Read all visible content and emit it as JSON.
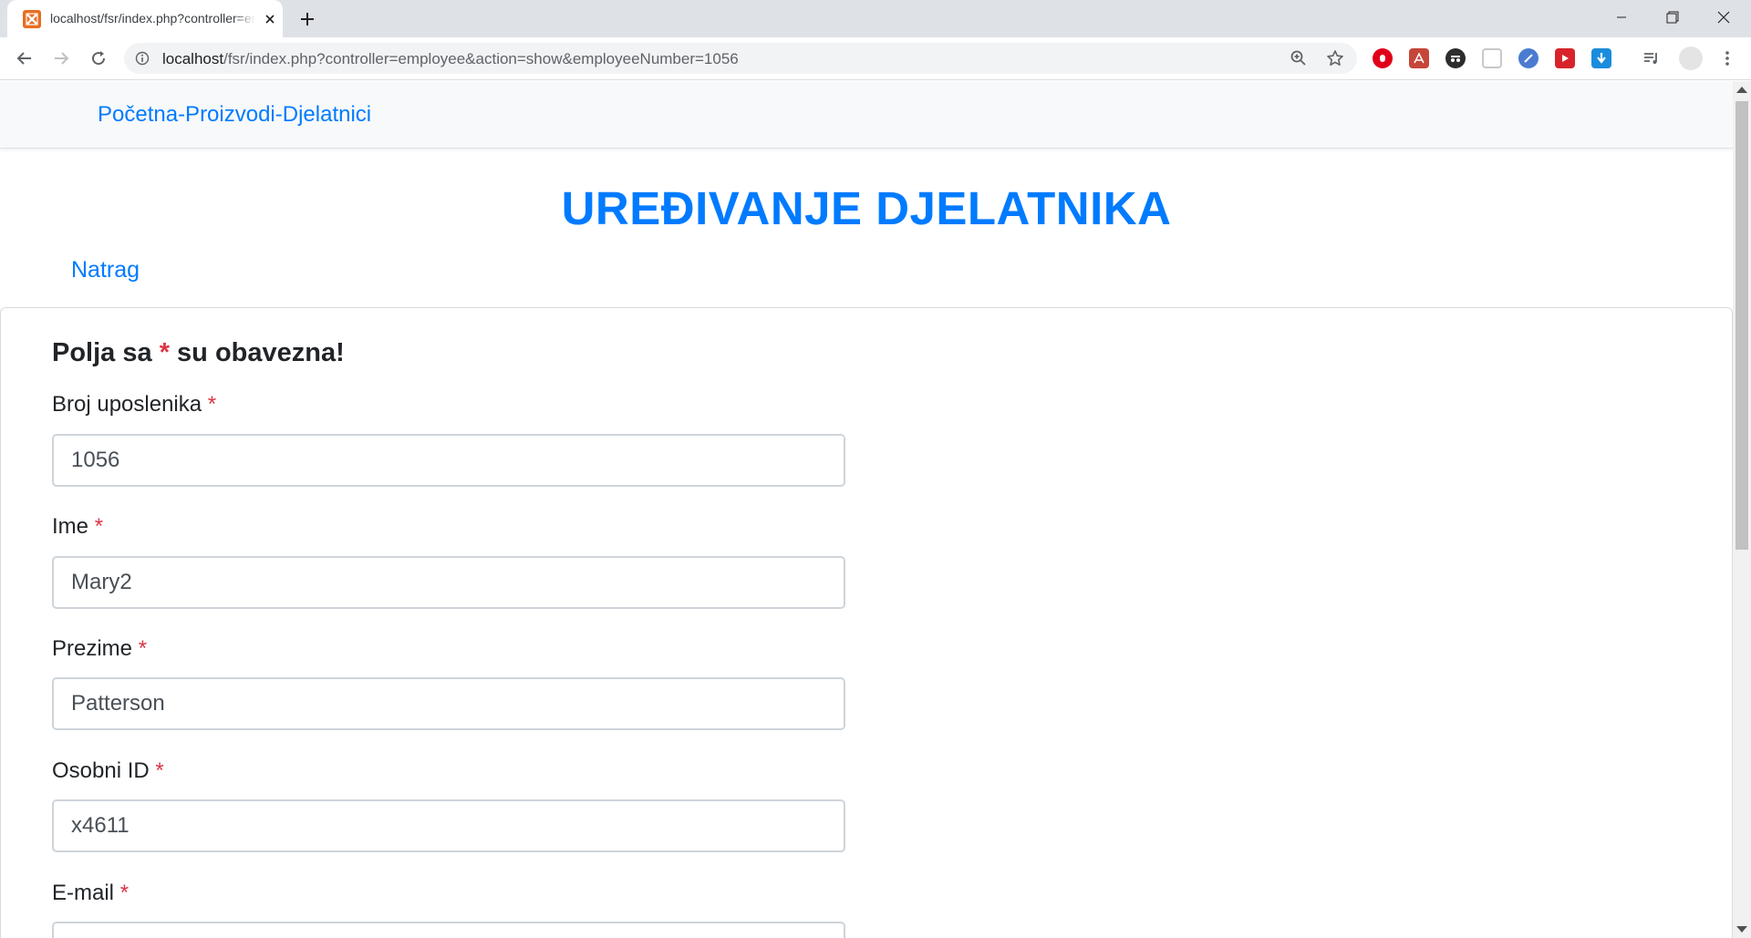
{
  "browser": {
    "tab_title": "localhost/fsr/index.php?controller=employee&action=show&employeeNumber=1056",
    "url_host": "localhost",
    "url_path": "/fsr/index.php?controller=employee&action=show&employeeNumber=1056"
  },
  "navbar": {
    "brand": "Početna-Proizvodi-Djelatnici"
  },
  "page": {
    "title": "UREĐIVANJE DJELATNIKA",
    "back_link": "Natrag"
  },
  "form": {
    "note_prefix": "Polja sa",
    "note_star": "*",
    "note_suffix": "su obavezna!",
    "required_marker": "*",
    "fields": [
      {
        "label": "Broj uposlenika",
        "value": "1056"
      },
      {
        "label": "Ime",
        "value": "Mary2"
      },
      {
        "label": "Prezime",
        "value": "Patterson"
      },
      {
        "label": "Osobni ID",
        "value": "x4611"
      },
      {
        "label": "E-mail",
        "value": ""
      }
    ]
  },
  "colors": {
    "link": "#007bff",
    "required": "#dc3545",
    "navbar_bg": "#f8f9fa"
  }
}
